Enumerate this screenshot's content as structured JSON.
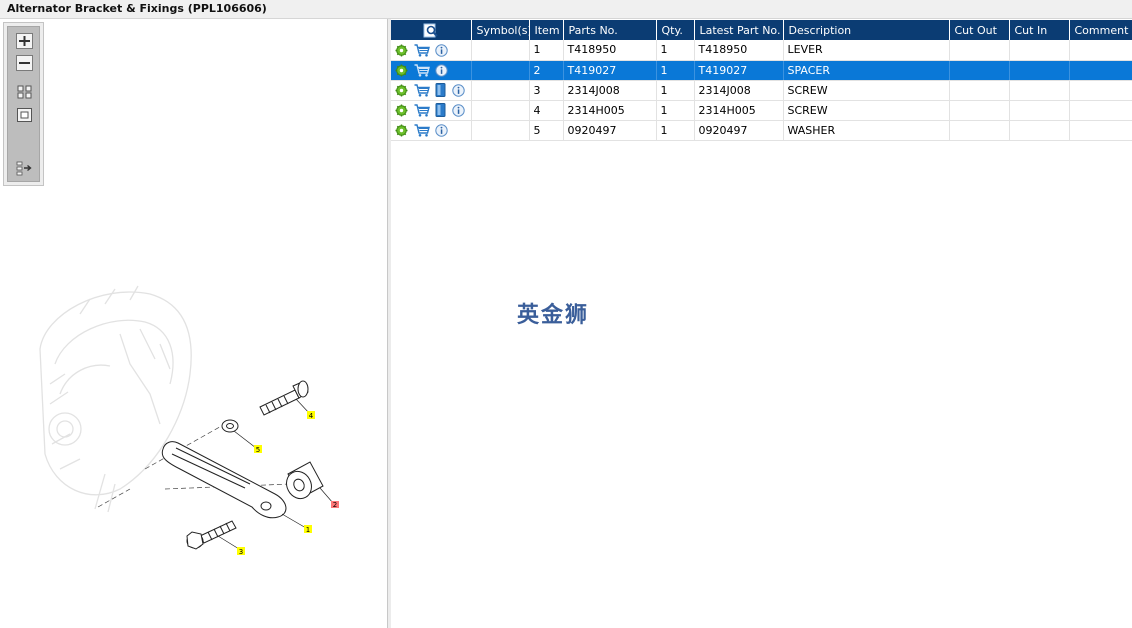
{
  "window": {
    "title": "Alternator Bracket & Fixings (PPL106606)"
  },
  "toolbox": {
    "buttons": [
      {
        "name": "zoom-in",
        "icon": "plus-icon"
      },
      {
        "name": "zoom-out",
        "icon": "minus-icon"
      },
      {
        "name": "fit-all",
        "icon": "fit-grid-icon"
      },
      {
        "name": "actual-size",
        "icon": "square-icon"
      },
      {
        "name": "toggle-list",
        "icon": "list-arrow-icon"
      }
    ]
  },
  "diagram": {
    "callouts": [
      {
        "label": "4",
        "color": "#ffff00"
      },
      {
        "label": "5",
        "color": "#ffff00"
      },
      {
        "label": "2",
        "color": "#ff7777"
      },
      {
        "label": "1",
        "color": "#ffff00"
      },
      {
        "label": "3",
        "color": "#ffff00"
      }
    ]
  },
  "table": {
    "columns": {
      "symbols": "Symbol(s)",
      "item": "Item",
      "parts_no": "Parts No.",
      "qty": "Qty.",
      "latest_part_no": "Latest Part No.",
      "description": "Description",
      "cut_out": "Cut Out",
      "cut_in": "Cut In",
      "comment": "Comment"
    },
    "rows": [
      {
        "item": "1",
        "parts_no": "T418950",
        "qty": "1",
        "latest_part_no": "T418950",
        "description": "LEVER",
        "cut_out": "",
        "cut_in": "",
        "comment": ""
      },
      {
        "item": "2",
        "parts_no": "T419027",
        "qty": "1",
        "latest_part_no": "T419027",
        "description": "SPACER",
        "cut_out": "",
        "cut_in": "",
        "comment": ""
      },
      {
        "item": "3",
        "parts_no": "2314J008",
        "qty": "1",
        "latest_part_no": "2314J008",
        "description": "SCREW",
        "cut_out": "",
        "cut_in": "",
        "comment": ""
      },
      {
        "item": "4",
        "parts_no": "2314H005",
        "qty": "1",
        "latest_part_no": "2314H005",
        "description": "SCREW",
        "cut_out": "",
        "cut_in": "",
        "comment": ""
      },
      {
        "item": "5",
        "parts_no": "0920497",
        "qty": "1",
        "latest_part_no": "0920497",
        "description": "WASHER",
        "cut_out": "",
        "cut_in": "",
        "comment": ""
      }
    ]
  },
  "watermark": {
    "text": "英金狮",
    "color": "#3a5e9a"
  },
  "colors": {
    "header": "#0b3c73",
    "selection": "#0a78d7"
  }
}
